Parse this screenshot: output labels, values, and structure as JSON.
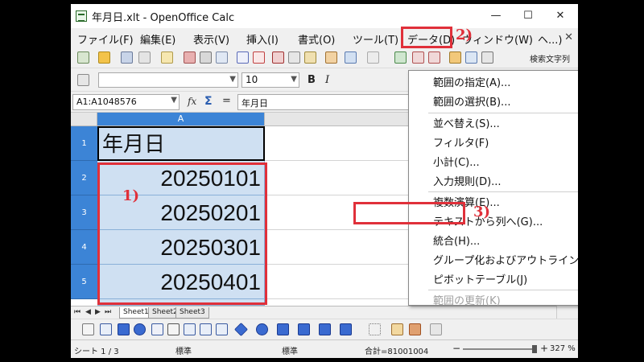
{
  "window": {
    "title": "年月日.xlt - OpenOffice Calc",
    "minimize_glyph": "—",
    "maximize_glyph": "☐",
    "close_glyph": "✕"
  },
  "menubar": {
    "items": [
      "ファイル(F)",
      "編集(E)",
      "表示(V)",
      "挿入(I)",
      "書式(O)",
      "ツール(T)",
      "データ(D)",
      "ウィンドウ(W)",
      "ヘ...)"
    ],
    "close_glyph": "✕"
  },
  "toolbar": {
    "search_label": "検索文字列"
  },
  "formatting": {
    "font_name": "",
    "font_size": "10",
    "bold_label": "B",
    "italic_label": "I"
  },
  "formula_bar": {
    "name_box": "A1:A1048576",
    "fx_label": "fx",
    "sigma_label": "Σ",
    "equals_label": "=",
    "content": "年月日"
  },
  "sheet": {
    "column_header": "A",
    "row_headers": [
      "1",
      "2",
      "3",
      "4",
      "5"
    ],
    "header_cell": "年月日",
    "values": [
      "20250101",
      "20250201",
      "20250301",
      "20250401"
    ]
  },
  "sheet_tabs": [
    "Sheet1",
    "Sheet2",
    "Sheet3"
  ],
  "nav_buttons": [
    "⏮",
    "◀",
    "▶",
    "⏭"
  ],
  "data_menu": {
    "items": [
      {
        "label": "範囲の指定(A)...",
        "submenu": false,
        "disabled": false
      },
      {
        "label": "範囲の選択(B)...",
        "submenu": false,
        "disabled": false
      },
      {
        "label": "並べ替え(S)...",
        "submenu": false,
        "disabled": false
      },
      {
        "label": "フィルタ(F)",
        "submenu": true,
        "disabled": false
      },
      {
        "label": "小計(C)...",
        "submenu": false,
        "disabled": false
      },
      {
        "label": "入力規則(D)...",
        "submenu": false,
        "disabled": false
      },
      {
        "label": "複数演算(E)...",
        "submenu": false,
        "disabled": false
      },
      {
        "label": "テキストから列へ(G)...",
        "submenu": false,
        "disabled": false
      },
      {
        "label": "統合(H)...",
        "submenu": false,
        "disabled": false
      },
      {
        "label": "グループ化およびアウトライン(I)",
        "submenu": true,
        "disabled": false
      },
      {
        "label": "ピボットテーブル(J)",
        "submenu": true,
        "disabled": false
      },
      {
        "label": "範囲の更新(K)",
        "submenu": false,
        "disabled": true
      }
    ],
    "submenu_arrow": "▶"
  },
  "annotations": {
    "step1": "1)",
    "step2": "2)",
    "step3": "3)",
    "color": "#e0303a"
  },
  "statusbar": {
    "sheet_info": "シート 1 / 3",
    "page_style": "標準",
    "mode": "標準",
    "sum": "合計=81001004",
    "zoom_minus": "−",
    "zoom_plus": "+",
    "zoom": "327 %",
    "zoom_level_percent": 327
  },
  "colors": {
    "selection_header": "#3c84d6",
    "selection_cell": "#cfe0f2",
    "highlight": "#e0303a"
  }
}
